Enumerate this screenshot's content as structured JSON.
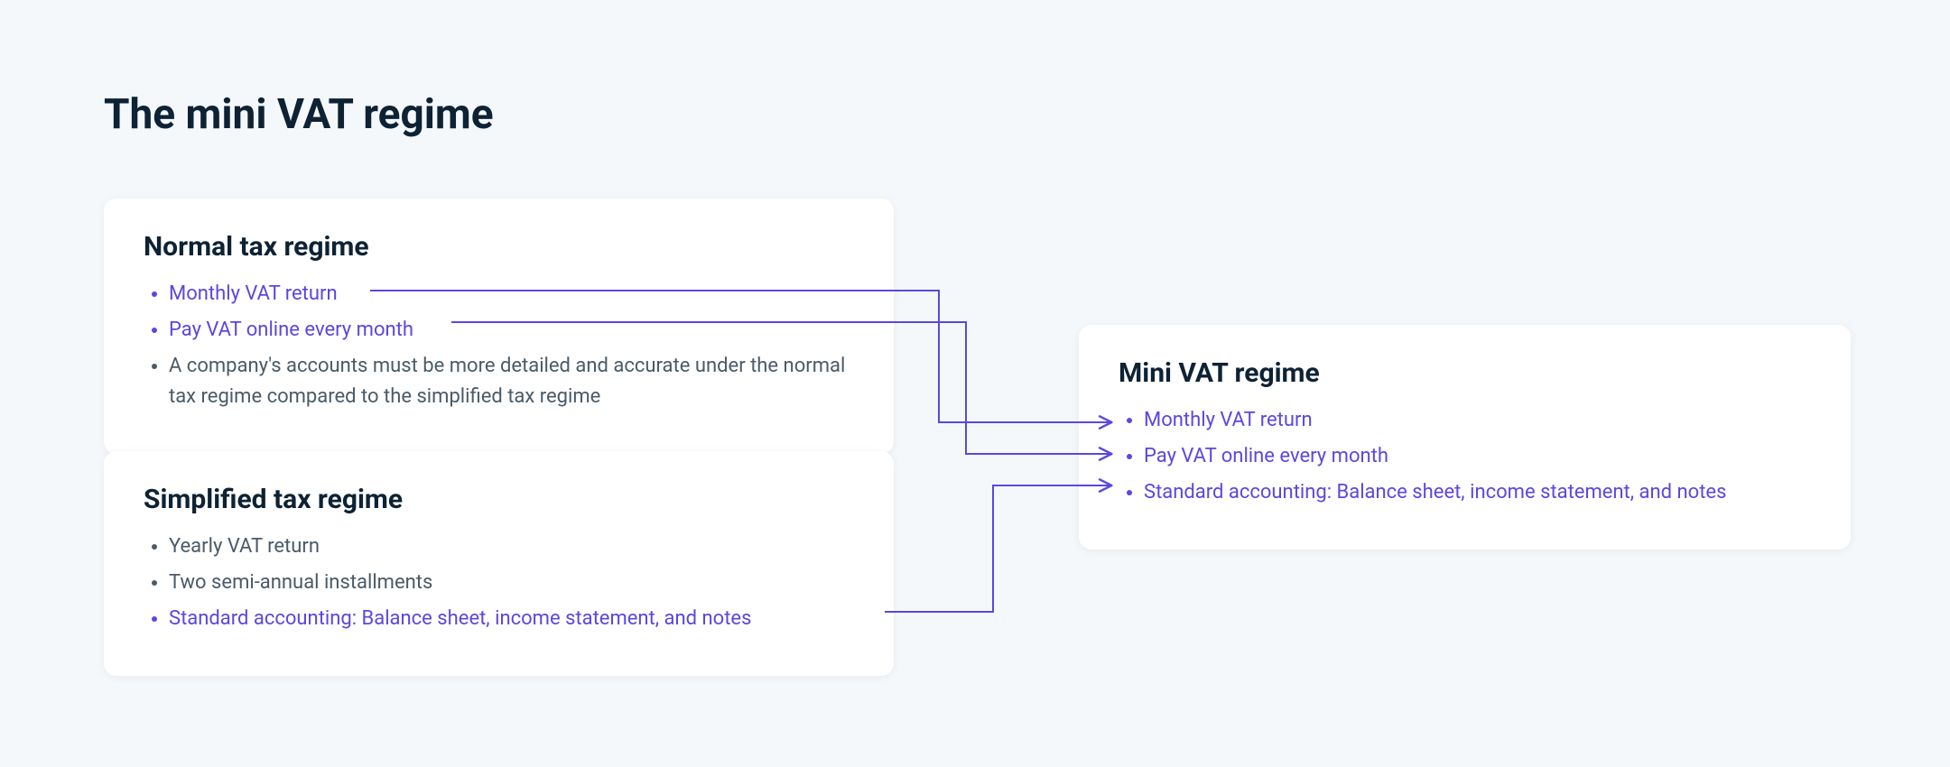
{
  "title": "The mini VAT regime",
  "colors": {
    "accent": "#5b47e0",
    "text": "#0d2235",
    "muted": "#4a5a68",
    "bg": "#f5f8fa",
    "card": "#ffffff"
  },
  "normal": {
    "heading": "Normal tax regime",
    "items": [
      {
        "text": "Monthly VAT return",
        "highlight": true
      },
      {
        "text": "Pay VAT online every month",
        "highlight": true
      },
      {
        "text": "A company's accounts must be more detailed and accurate under the normal tax regime compared to the simplified tax regime",
        "highlight": false
      }
    ]
  },
  "simplified": {
    "heading": "Simplified tax regime",
    "items": [
      {
        "text": "Yearly VAT return",
        "highlight": false
      },
      {
        "text": "Two semi-annual installments",
        "highlight": false
      },
      {
        "text": "Standard accounting: Balance sheet, income statement, and notes",
        "highlight": true
      }
    ]
  },
  "mini": {
    "heading": "Mini VAT regime",
    "items": [
      {
        "text": "Monthly VAT return",
        "highlight": true
      },
      {
        "text": "Pay VAT online every month",
        "highlight": true
      },
      {
        "text": "Standard accounting: Balance sheet, income statement, and notes",
        "highlight": true
      }
    ]
  }
}
